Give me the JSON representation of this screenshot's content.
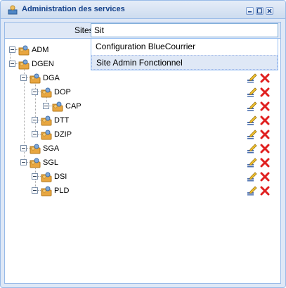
{
  "window": {
    "title": "Administration des services",
    "tools": [
      "minimize-icon",
      "maximize-icon",
      "close-icon"
    ]
  },
  "sites": {
    "label": "Sites:",
    "value": "Sit",
    "suggestions": [
      "Configuration BlueCourrier",
      "Site Admin Fonctionnel"
    ],
    "selected_index": 1
  },
  "tree": {
    "nodes": [
      {
        "label": "ADM",
        "expanded": true,
        "has_actions": false
      },
      {
        "label": "DGEN",
        "expanded": true,
        "has_actions": false
      },
      {
        "label": "DGA",
        "expanded": true,
        "has_actions": true
      },
      {
        "label": "DOP",
        "expanded": true,
        "has_actions": true
      },
      {
        "label": "CAP",
        "expanded": true,
        "has_actions": true
      },
      {
        "label": "DTT",
        "expanded": true,
        "has_actions": true
      },
      {
        "label": "DZIP",
        "expanded": true,
        "has_actions": true
      },
      {
        "label": "SGA",
        "expanded": true,
        "has_actions": true
      },
      {
        "label": "SGL",
        "expanded": true,
        "has_actions": true
      },
      {
        "label": "DSI",
        "expanded": true,
        "has_actions": true
      },
      {
        "label": "PLD",
        "expanded": true,
        "has_actions": true
      }
    ],
    "icons": {
      "node": "services-folder-icon",
      "edit": "edit-pencil-icon",
      "delete": "delete-x-icon"
    }
  },
  "colors": {
    "title": "#15428b",
    "border": "#99bbe8",
    "delete": "#e02020",
    "folder": "#e8a640"
  }
}
